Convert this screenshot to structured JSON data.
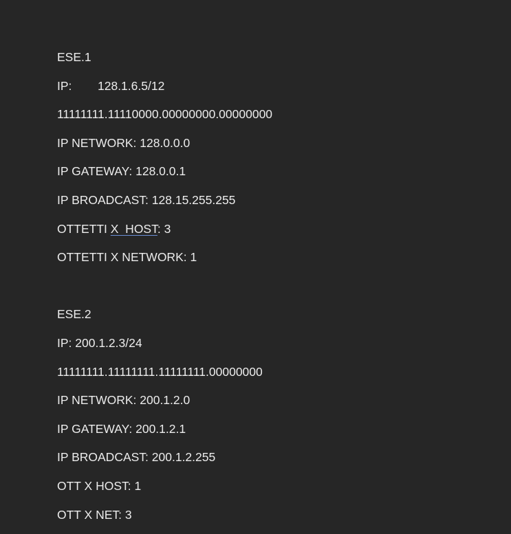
{
  "exercises": [
    {
      "title": "ESE.1",
      "ip_label": "IP:",
      "ip_value": "128.1.6.5/12",
      "mask_binary": "11111111.11110000.00000000.00000000",
      "network": "IP NETWORK: 128.0.0.0",
      "gateway": "IP GATEWAY: 128.0.0.1",
      "broadcast": "IP BROADCAST: 128.15.255.255",
      "host_octets_prefix": "OTTETTI ",
      "host_octets_flagged": "X  HOST",
      "host_octets_suffix": ": 3",
      "network_octets": "OTTETTI X NETWORK: 1"
    },
    {
      "title": "ESE.2",
      "ip": "IP: 200.1.2.3/24",
      "mask_binary": "11111111.11111111.11111111.00000000",
      "network": "IP NETWORK: 200.1.2.0",
      "gateway": "IP GATEWAY: 200.1.2.1",
      "broadcast": "IP BROADCAST: 200.1.2.255",
      "host_octets": "OTT X HOST: 1",
      "network_octets": "OTT X NET: 3"
    }
  ]
}
